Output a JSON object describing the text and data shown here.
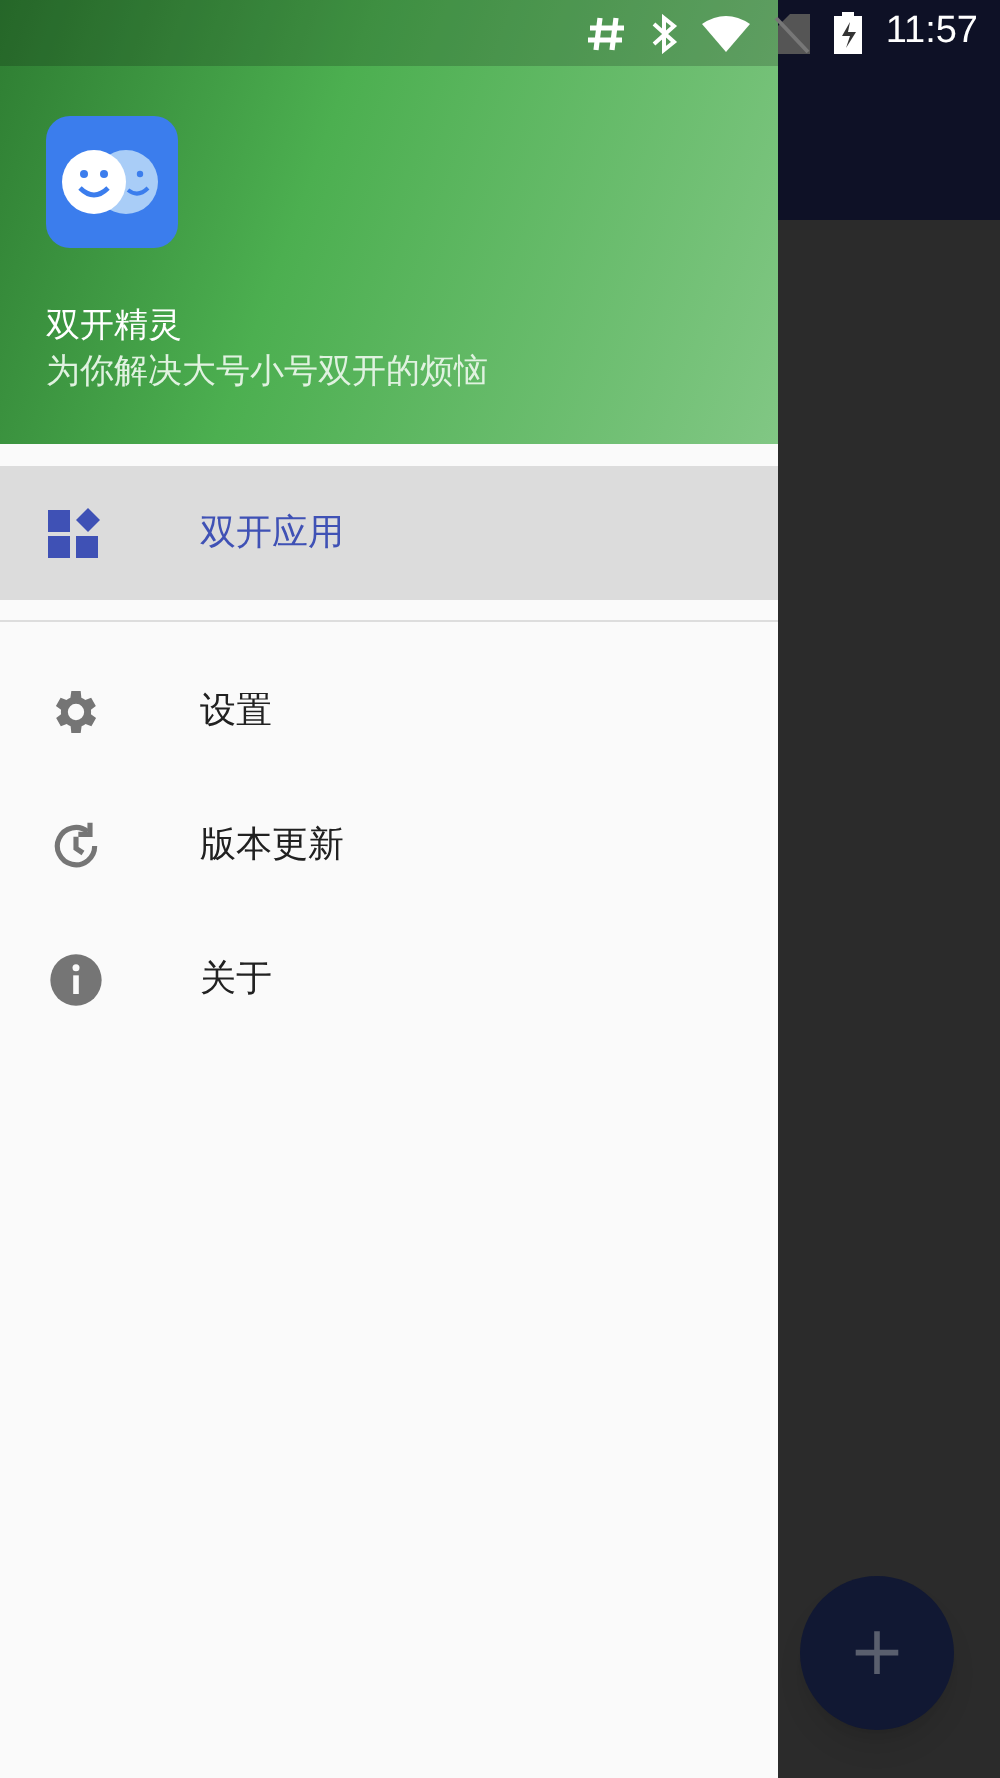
{
  "status_bar": {
    "time": "11:57"
  },
  "drawer": {
    "app_name": "双开精灵",
    "tagline": "为你解决大号小号双开的烦恼",
    "items": [
      {
        "label": "双开应用",
        "kind": "apps",
        "selected": true
      },
      {
        "label": "设置",
        "kind": "settings",
        "selected": false
      },
      {
        "label": "版本更新",
        "kind": "update",
        "selected": false
      },
      {
        "label": "关于",
        "kind": "info",
        "selected": false
      }
    ]
  },
  "fab": {
    "label": "+"
  }
}
